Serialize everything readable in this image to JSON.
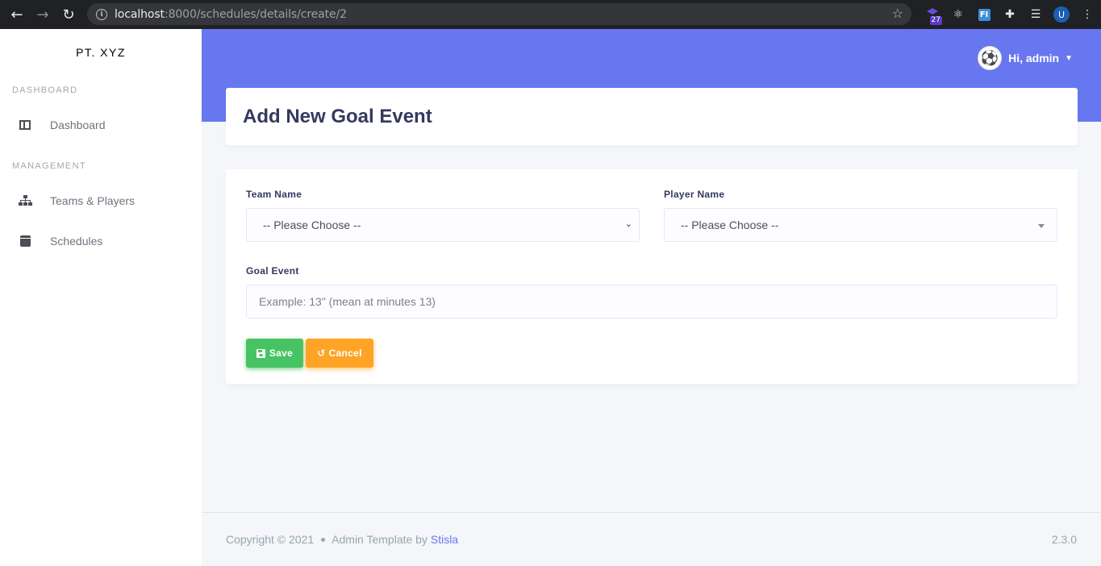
{
  "browser": {
    "url_host": "localhost",
    "url_path": ":8000/schedules/details/create/2",
    "extension_badge": "27",
    "extension_fi": "FI",
    "profile_initial": "U"
  },
  "sidebar": {
    "brand": "PT. XYZ",
    "sections": [
      {
        "header": "DASHBOARD",
        "items": [
          {
            "label": "Dashboard",
            "icon": "columns-icon"
          }
        ]
      },
      {
        "header": "MANAGEMENT",
        "items": [
          {
            "label": "Teams & Players",
            "icon": "sitemap-icon"
          },
          {
            "label": "Schedules",
            "icon": "calendar-icon"
          }
        ]
      }
    ]
  },
  "navbar": {
    "greeting": "Hi, admin"
  },
  "page": {
    "title": "Add New Goal Event"
  },
  "form": {
    "team_label": "Team Name",
    "team_value": "-- Please Choose --",
    "player_label": "Player Name",
    "player_value": "-- Please Choose --",
    "goal_label": "Goal Event",
    "goal_placeholder": "Example: 13\" (mean at minutes 13)",
    "save_label": "Save",
    "cancel_label": "Cancel"
  },
  "footer": {
    "copyright": "Copyright © 2021",
    "template_text": "Admin Template by",
    "template_link": "Stisla",
    "version": "2.3.0"
  },
  "colors": {
    "primary": "#6777ef",
    "success": "#47c363",
    "warning": "#ffa426"
  }
}
